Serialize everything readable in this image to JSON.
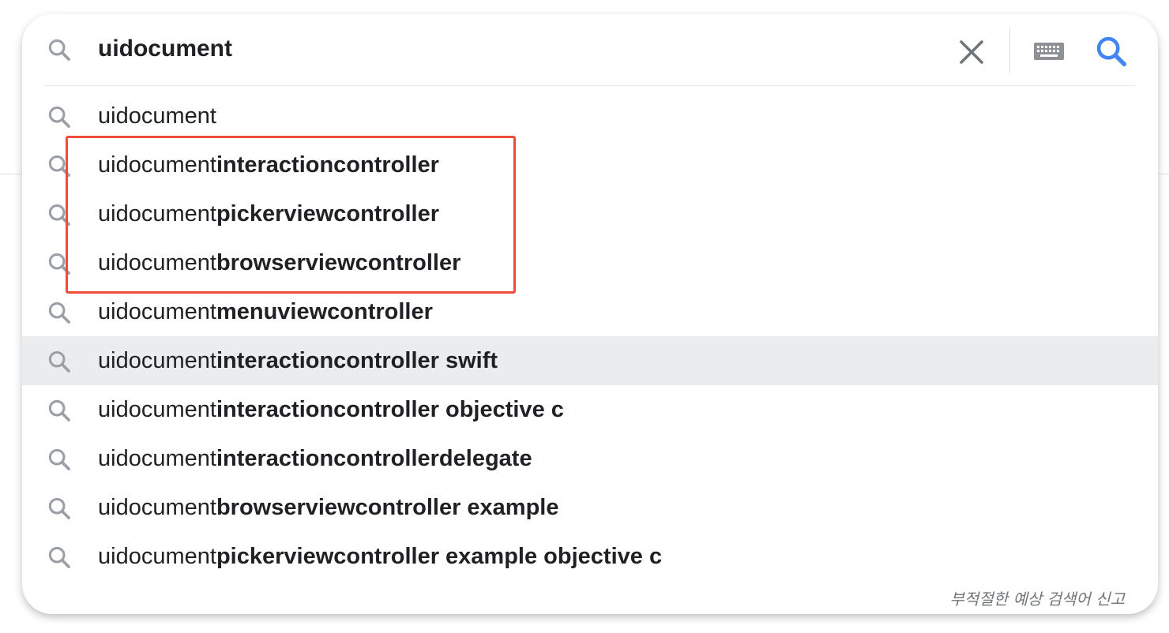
{
  "search": {
    "query": "uidocument"
  },
  "suggestions": [
    {
      "prefix": "uidocument",
      "suffix": ""
    },
    {
      "prefix": "uidocument",
      "suffix": "interactioncontroller"
    },
    {
      "prefix": "uidocument",
      "suffix": "pickerviewcontroller"
    },
    {
      "prefix": "uidocument",
      "suffix": "browserviewcontroller"
    },
    {
      "prefix": "uidocument",
      "suffix": "menuviewcontroller"
    },
    {
      "prefix": "uidocument",
      "suffix": "interactioncontroller swift"
    },
    {
      "prefix": "uidocument",
      "suffix": "interactioncontroller objective c"
    },
    {
      "prefix": "uidocument",
      "suffix": "interactioncontrollerdelegate"
    },
    {
      "prefix": "uidocument",
      "suffix": "browserviewcontroller example"
    },
    {
      "prefix": "uidocument",
      "suffix": "pickerviewcontroller example objective c"
    }
  ],
  "footer": {
    "report_label": "부적절한 예상 검색어 신고"
  },
  "icons": {
    "leading": "search-icon",
    "clear": "close-icon",
    "keyboard": "keyboard-icon",
    "submit": "search-icon"
  },
  "colors": {
    "accent_blue": "#4285f4",
    "icon_gray": "#9aa0a6",
    "highlight_row": "#ebecee",
    "annotation_red": "#ee4d3a"
  }
}
